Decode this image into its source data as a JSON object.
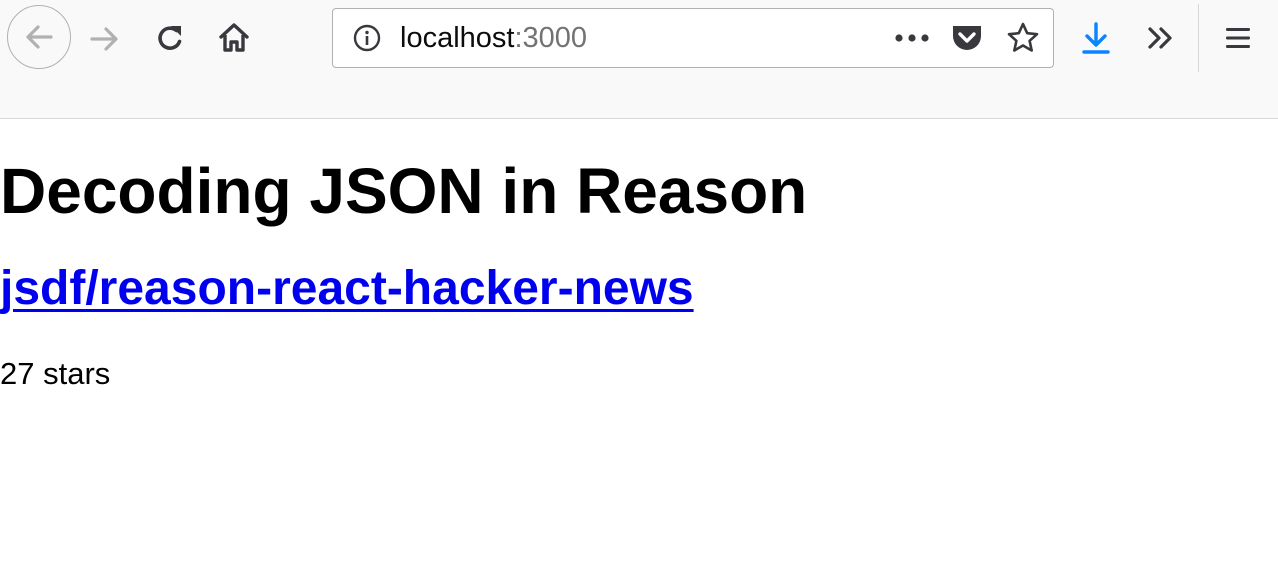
{
  "browser": {
    "url_host": "localhost",
    "url_port": ":3000",
    "icons": {
      "back": "arrow-left-icon",
      "forward": "arrow-right-icon",
      "reload": "reload-icon",
      "home": "home-icon",
      "site_info": "info-icon",
      "page_actions": "more-horizontal-icon",
      "pocket": "pocket-icon",
      "bookmark": "star-icon",
      "downloads": "download-icon",
      "overflow": "chevron-double-right-icon",
      "menu": "hamburger-menu-icon"
    },
    "colors": {
      "toolbar_bg": "#f9f9fa",
      "download_accent": "#0a84ff",
      "link": "#0000ee"
    }
  },
  "page": {
    "title": "Decoding JSON in Reason",
    "repo_name": "jsdf/reason-react-hacker-news",
    "stars_text": "27 stars"
  }
}
